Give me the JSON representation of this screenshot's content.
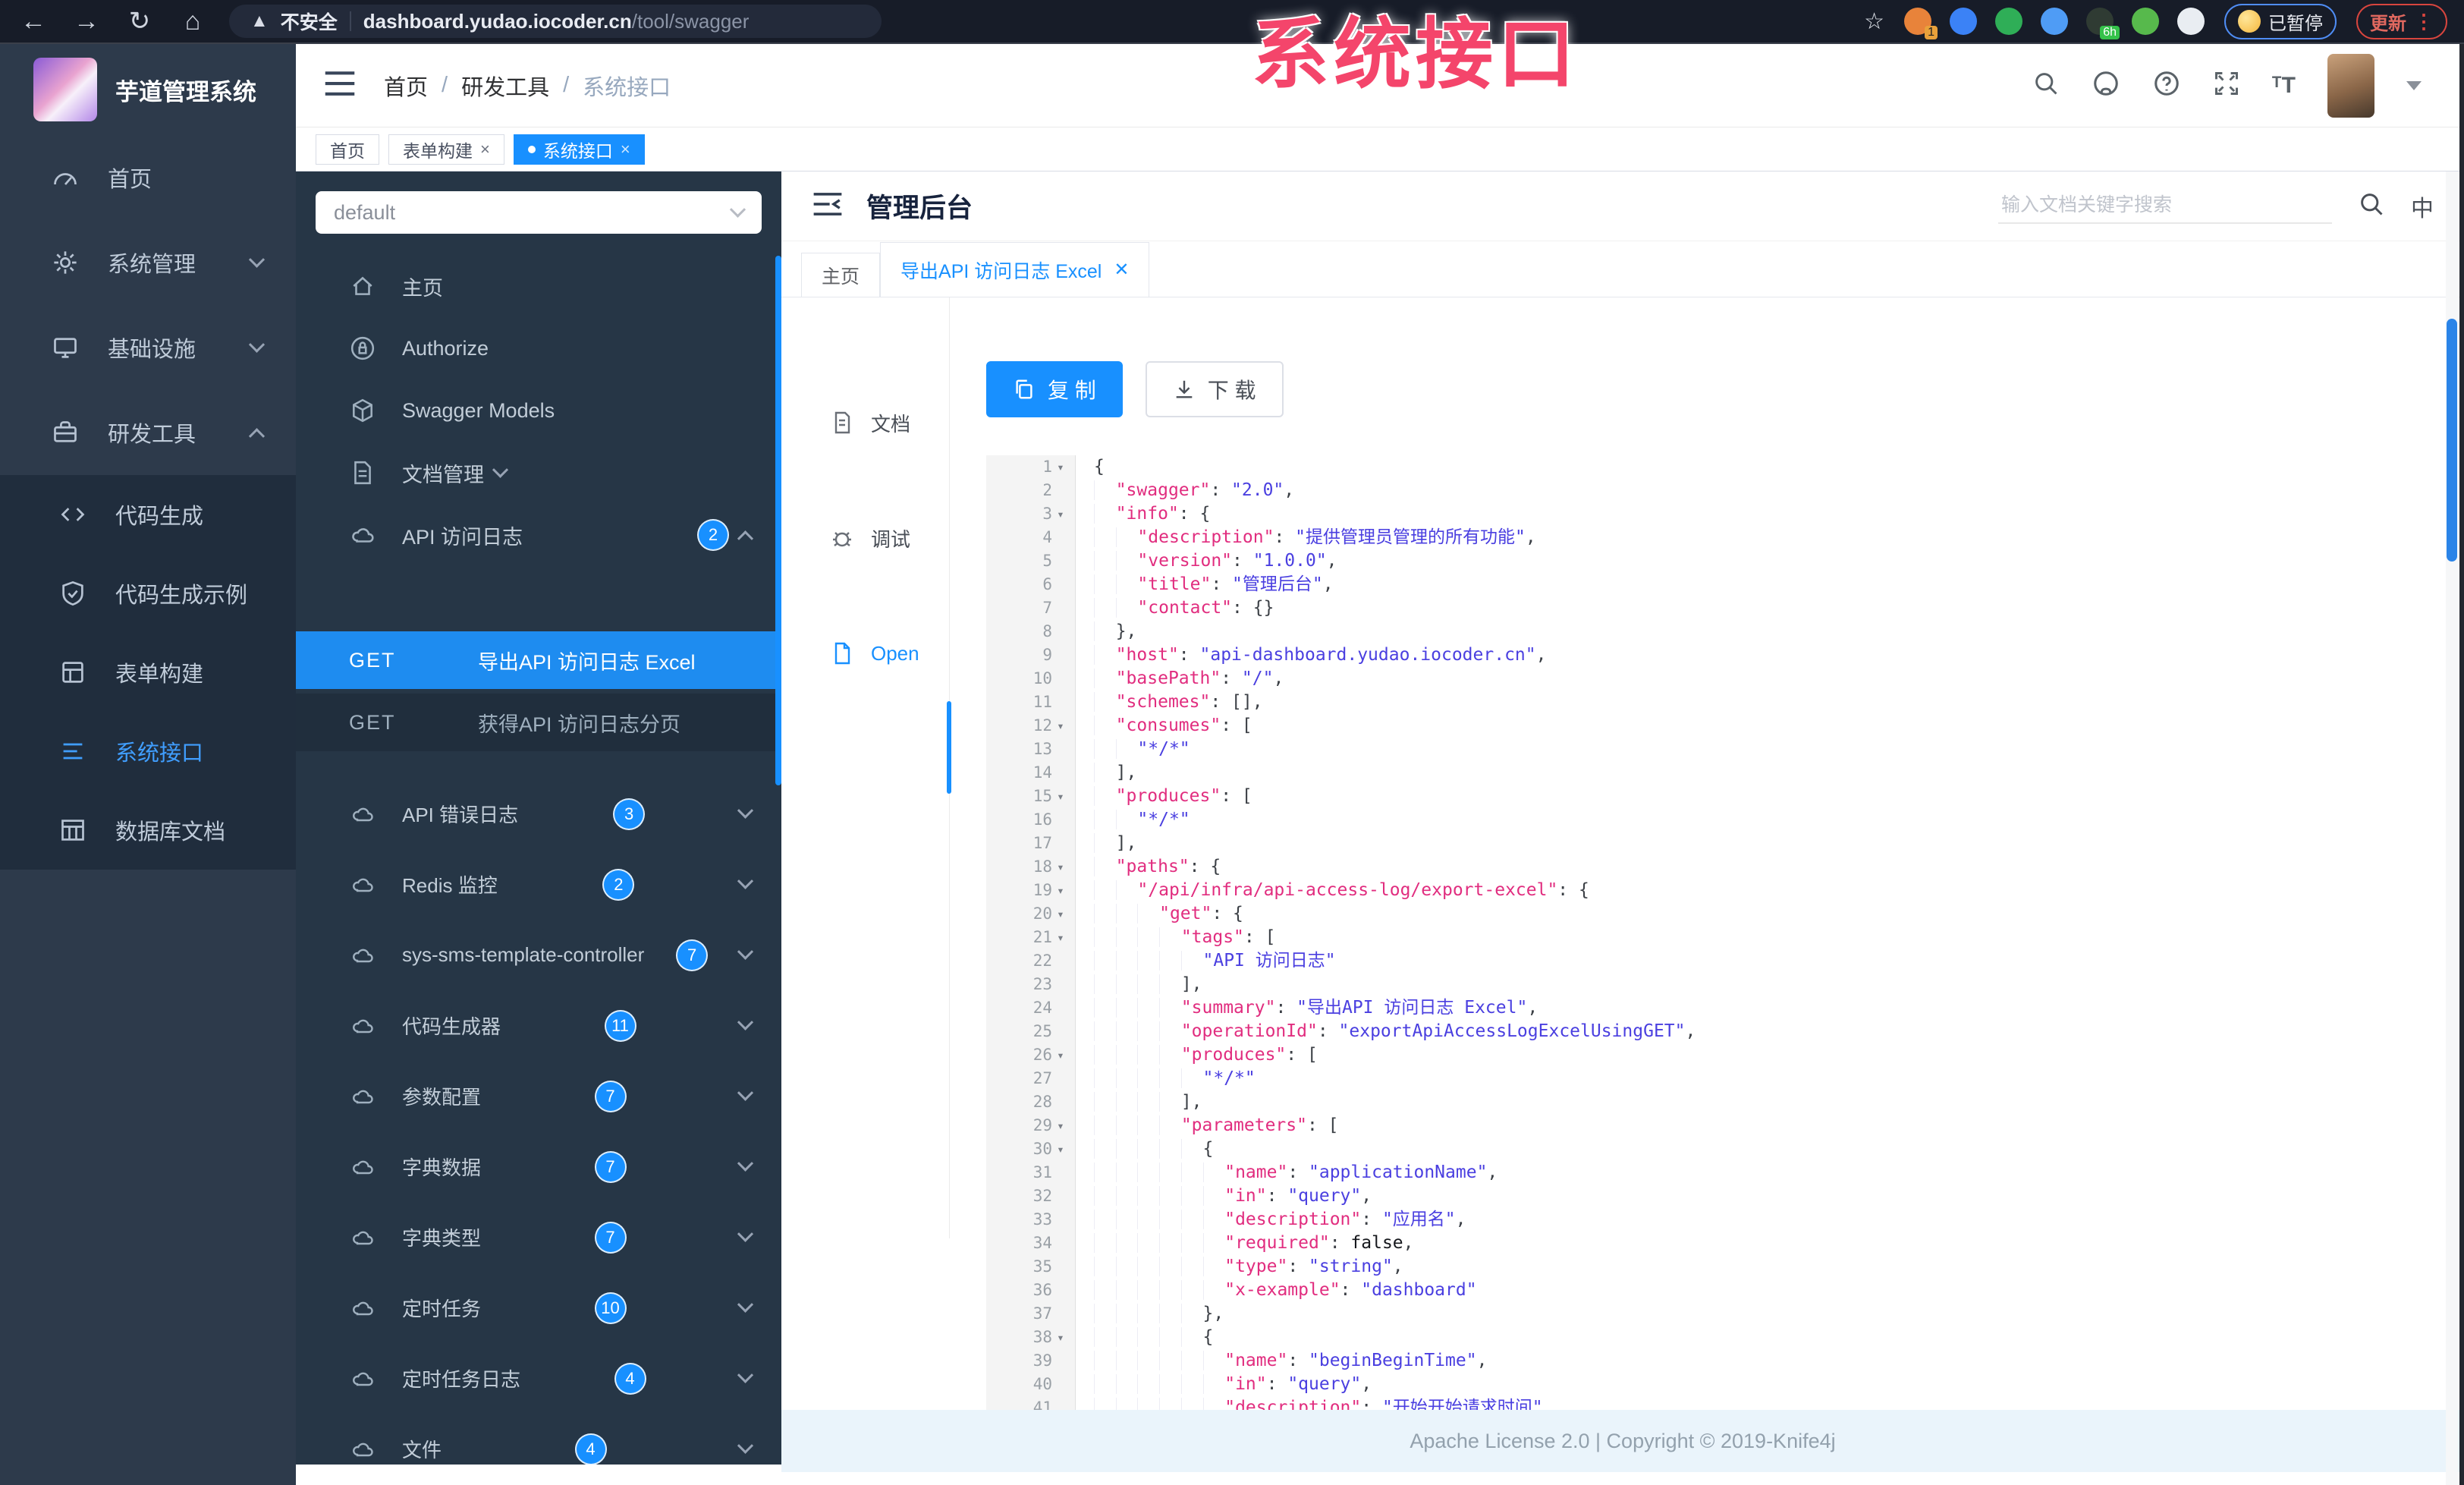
{
  "overlay_title": "系统接口",
  "browser": {
    "security_label": "不安全",
    "url_host": "dashboard.yudao.iocoder.cn",
    "url_path": "/tool/swagger",
    "paused_label": "已暂停",
    "update_label": "更新",
    "extensions": [
      {
        "name": "extension-orange",
        "color": "#e8833a",
        "badge": "1"
      },
      {
        "name": "extension-blue-drop",
        "color": "#3b82f6",
        "badge": ""
      },
      {
        "name": "extension-green-circle",
        "color": "#2fae57",
        "badge": ""
      },
      {
        "name": "extension-blue-grid",
        "color": "#4f9cf5",
        "badge": ""
      },
      {
        "name": "extension-dark-bottle",
        "color": "#2f3b33",
        "badge": "6h"
      },
      {
        "name": "extension-green-leaf",
        "color": "#57b94c",
        "badge": ""
      },
      {
        "name": "extension-white-paw",
        "color": "#e9edf2",
        "badge": ""
      }
    ]
  },
  "sidebar": {
    "app_title": "芋道管理系统",
    "items": [
      {
        "label": "首页"
      },
      {
        "label": "系统管理"
      },
      {
        "label": "基础设施"
      },
      {
        "label": "研发工具"
      }
    ],
    "subitems": [
      {
        "label": "代码生成"
      },
      {
        "label": "代码生成示例"
      },
      {
        "label": "表单构建"
      },
      {
        "label": "系统接口"
      },
      {
        "label": "数据库文档"
      }
    ]
  },
  "app_header": {
    "breadcrumb": [
      "首页",
      "研发工具",
      "系统接口"
    ],
    "lang_icon": "T"
  },
  "tags_view": {
    "tabs": [
      {
        "label": "首页"
      },
      {
        "label": "表单构建"
      },
      {
        "label": "系统接口"
      }
    ]
  },
  "swagger_panel": {
    "group_select": "default",
    "nav": [
      {
        "label": "主页"
      },
      {
        "label": "Authorize"
      },
      {
        "label": "Swagger Models"
      },
      {
        "label": "文档管理"
      }
    ],
    "api_log_group": {
      "label": "API 访问日志",
      "badge": "2"
    },
    "operations": [
      {
        "method": "GET",
        "name": "导出API 访问日志 Excel"
      },
      {
        "method": "GET",
        "name": "获得API 访问日志分页"
      }
    ],
    "groups": [
      {
        "label": "API 错误日志",
        "badge": "3"
      },
      {
        "label": "Redis 监控",
        "badge": "2"
      },
      {
        "label": "sys-sms-template-controller",
        "badge": "7"
      },
      {
        "label": "代码生成器",
        "badge": "11"
      },
      {
        "label": "参数配置",
        "badge": "7"
      },
      {
        "label": "字典数据",
        "badge": "7"
      },
      {
        "label": "字典类型",
        "badge": "7"
      },
      {
        "label": "定时任务",
        "badge": "10"
      },
      {
        "label": "定时任务日志",
        "badge": "4"
      },
      {
        "label": "文件",
        "badge": "4"
      }
    ]
  },
  "doc": {
    "title": "管理后台",
    "search_placeholder": "输入文档关键字搜索",
    "lang_label": "中",
    "tabs": [
      {
        "label": "主页"
      },
      {
        "label": "导出API 访问日志 Excel"
      }
    ],
    "side_nav": [
      {
        "label": "文档"
      },
      {
        "label": "调试"
      },
      {
        "label": "Open"
      }
    ],
    "copy_label": "复 制",
    "download_label": "下 载"
  },
  "code": {
    "fold_lines": [
      1,
      3,
      12,
      15,
      18,
      19,
      20,
      21,
      26,
      29,
      30,
      38
    ],
    "lines": [
      "{",
      "  \"swagger\": \"2.0\",",
      "  \"info\": {",
      "    \"description\": \"提供管理员管理的所有功能\",",
      "    \"version\": \"1.0.0\",",
      "    \"title\": \"管理后台\",",
      "    \"contact\": {}",
      "  },",
      "  \"host\": \"api-dashboard.yudao.iocoder.cn\",",
      "  \"basePath\": \"/\",",
      "  \"schemes\": [],",
      "  \"consumes\": [",
      "    \"*/*\"",
      "  ],",
      "  \"produces\": [",
      "    \"*/*\"",
      "  ],",
      "  \"paths\": {",
      "    \"/api/infra/api-access-log/export-excel\": {",
      "      \"get\": {",
      "        \"tags\": [",
      "          \"API 访问日志\"",
      "        ],",
      "        \"summary\": \"导出API 访问日志 Excel\",",
      "        \"operationId\": \"exportApiAccessLogExcelUsingGET\",",
      "        \"produces\": [",
      "          \"*/*\"",
      "        ],",
      "        \"parameters\": [",
      "          {",
      "            \"name\": \"applicationName\",",
      "            \"in\": \"query\",",
      "            \"description\": \"应用名\",",
      "            \"required\": false,",
      "            \"type\": \"string\",",
      "            \"x-example\": \"dashboard\"",
      "          },",
      "          {",
      "            \"name\": \"beginBeginTime\",",
      "            \"in\": \"query\",",
      "            \"description\": \"开始开始请求时间\""
    ]
  },
  "footer": {
    "text": "Apache License 2.0 | Copyright © 2019-Knife4j"
  }
}
